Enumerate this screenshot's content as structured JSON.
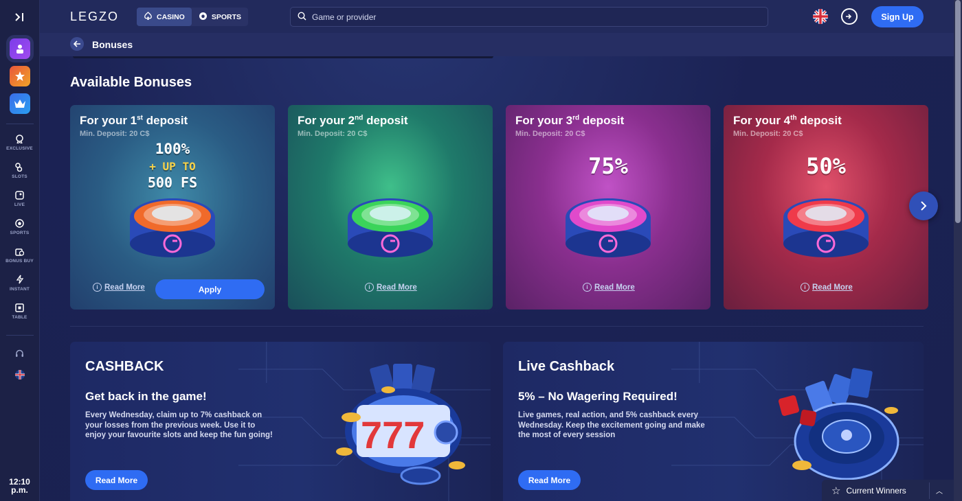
{
  "sidebar": {
    "toggle_icon": "collapse-right-icon",
    "promos": [
      "user-icon",
      "star-icon",
      "crown-icon"
    ],
    "items": [
      {
        "label": "EXCLUSIVE",
        "icon": "exclusive-icon"
      },
      {
        "label": "SLOTS",
        "icon": "slots-icon"
      },
      {
        "label": "LIVE",
        "icon": "live-icon"
      },
      {
        "label": "SPORTS",
        "icon": "sports-icon"
      },
      {
        "label": "BONUS BUY",
        "icon": "bonus-buy-icon"
      },
      {
        "label": "INSTANT",
        "icon": "instant-icon"
      },
      {
        "label": "TABLE",
        "icon": "table-icon"
      }
    ],
    "time_line1": "12:10",
    "time_line2": "p.m."
  },
  "header": {
    "logo": "LEGZO",
    "tabs": [
      {
        "label": "CASINO",
        "active": true
      },
      {
        "label": "SPORTS",
        "active": false
      }
    ],
    "search_placeholder": "Game or provider",
    "signup_label": "Sign Up"
  },
  "page": {
    "title": "Bonuses",
    "section_title": "Available Bonuses"
  },
  "bonus_cards": [
    {
      "prefix": "For your 1",
      "sup": "st",
      "suffix": " deposit",
      "min": "Min. Deposit: 20 C$",
      "offer_l1": "100%",
      "offer_l2": "+ UP TO",
      "offer_l3": "500 FS",
      "read_more": "Read More",
      "apply": "Apply",
      "ring_color": "#f06a2a"
    },
    {
      "prefix": "For your 2",
      "sup": "nd",
      "suffix": " deposit",
      "min": "Min. Deposit: 20 C$",
      "offer": "",
      "read_more": "Read More",
      "ring_color": "#3bd45a"
    },
    {
      "prefix": "For your 3",
      "sup": "rd",
      "suffix": " deposit",
      "min": "Min. Deposit: 20 C$",
      "offer": "75%",
      "read_more": "Read More",
      "ring_color": "#e04acb"
    },
    {
      "prefix": "For your 4",
      "sup": "th",
      "suffix": " deposit",
      "min": "Min. Deposit: 20 C$",
      "offer": "50%",
      "read_more": "Read More",
      "ring_color": "#ef3a4a"
    }
  ],
  "promos": [
    {
      "title": "CASHBACK",
      "subtitle": "Get back in the game!",
      "description": "Every Wednesday, claim up to 7% cashback on your losses from the previous week. Use it to enjoy your favourite slots and keep the fun going!",
      "button": "Read More"
    },
    {
      "title": "Live Cashback",
      "subtitle": "5% – No Wagering Required!",
      "description": "Live games, real action, and 5% cashback every Wednesday. Keep the excitement going and make the most of every session",
      "button": "Read More"
    }
  ],
  "winners": {
    "label": "Current Winners"
  },
  "colors": {
    "accent": "#2f6cf3",
    "background": "#1a2150"
  }
}
